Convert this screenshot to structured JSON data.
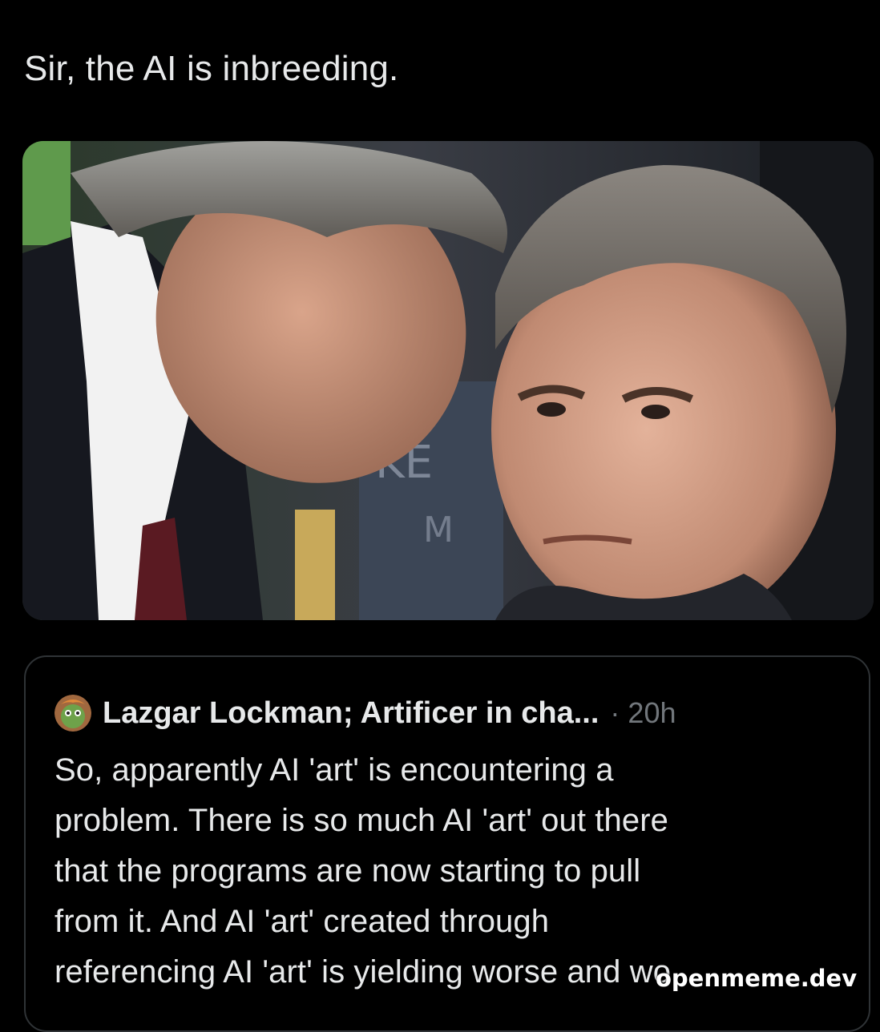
{
  "post": {
    "text": "Sir, the AI is inbreeding."
  },
  "media": {
    "photo_text_1": "KE",
    "photo_text_2": "M"
  },
  "quote": {
    "author_name": "Lazgar Lockman; Artificer in cha...",
    "separator": "·",
    "time": "20h",
    "lines": [
      "So, apparently AI 'art' is encountering a",
      "problem.  There is so much AI 'art' out there",
      "that the programs are now starting to pull",
      "from it.  And AI 'art' created through",
      "referencing AI 'art' is yielding worse and wo"
    ]
  },
  "watermark": {
    "text": "openmeme.dev"
  },
  "colors": {
    "background": "#000000",
    "text_primary": "#e7e9ea",
    "text_secondary": "#71767b",
    "border": "#2f3336"
  }
}
